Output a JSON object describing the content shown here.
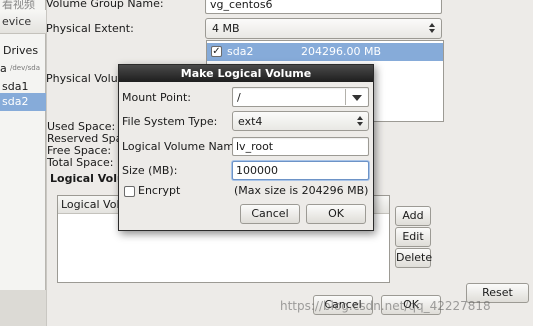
{
  "left_panel": {
    "header": "evice",
    "items": [
      {
        "label": "Drives",
        "selected": false
      },
      {
        "label": "a",
        "sub": "/dev/sda",
        "selected": false
      },
      {
        "label": "sda1",
        "selected": false
      },
      {
        "label": "sda2",
        "selected": true
      }
    ]
  },
  "watermark_top": "看视频",
  "volume_group": {
    "name_label": "Volume Group Name:",
    "name_value": "vg_centos6",
    "extent_label": "Physical Extent:",
    "extent_value": "4 MB",
    "pv_label": "Physical Volume",
    "pv_rows": [
      {
        "checked": true,
        "device": "sda2",
        "size": "204296.00 MB"
      }
    ],
    "space_labels": [
      "Used Space:",
      "Reserved Spac",
      "Free Space:",
      "Total Space:"
    ],
    "lv_section_label": "Logical Volu",
    "lv_table_header": "Logical Volu",
    "side_buttons": {
      "add": "Add",
      "edit": "Edit",
      "delete": "Delete"
    },
    "bottom_buttons": {
      "cancel": "Cancel",
      "ok": "OK",
      "reset": "Reset"
    }
  },
  "modal": {
    "title": "Make Logical Volume",
    "mount_point_label": "Mount Point:",
    "mount_point_value": "/",
    "fs_type_label": "File System Type:",
    "fs_type_value": "ext4",
    "lv_name_label": "Logical Volume Name:",
    "lv_name_value": "lv_root",
    "size_label": "Size (MB):",
    "size_value": "100000",
    "encrypt_label": "Encrypt",
    "encrypt_checked": false,
    "max_size_text": "(Max size is 204296 MB)",
    "cancel_label": "Cancel",
    "ok_label": "OK"
  },
  "watermark_bottom": "https://blog.csdn.net/qq_42227818"
}
